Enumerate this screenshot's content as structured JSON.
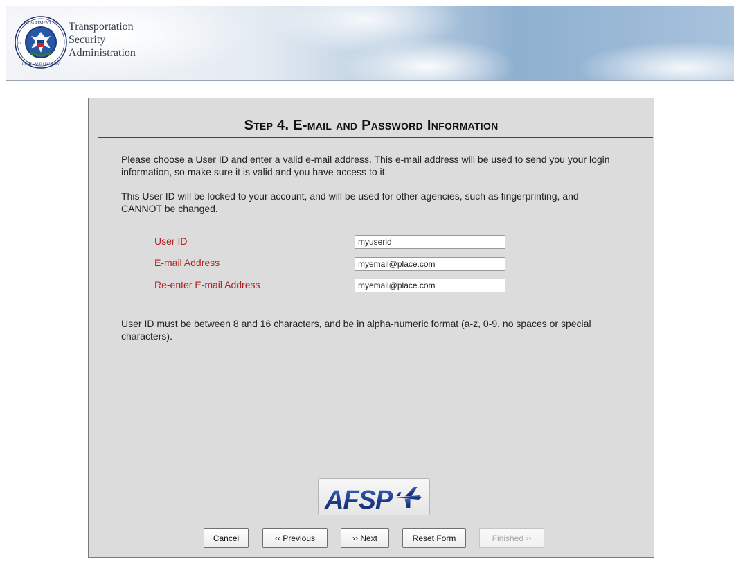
{
  "header": {
    "agency_lines": [
      "Transportation",
      "Security",
      "Administration"
    ],
    "seal_icon": "dhs-seal-icon",
    "seal_text_top": "DEPARTMENT OF",
    "seal_text_left": "U.S.",
    "seal_text_bottom": "HOMELAND SECURITY"
  },
  "step": {
    "title": "Step 4. E-mail and Password Information",
    "intro_paragraph_1": "Please choose a User ID and enter a valid e-mail address. This e-mail address will be used to send you your login information, so make sure it is valid and you have access to it.",
    "intro_paragraph_2": "This User ID will be locked to your account, and will be used for other agencies, such as fingerprinting, and CANNOT be changed."
  },
  "form": {
    "userid": {
      "label": "User ID",
      "value": "myuserid"
    },
    "email": {
      "label": "E-mail Address",
      "value": "myemail@place.com"
    },
    "reemail": {
      "label": "Re-enter E-mail Address",
      "value": "myemail@place.com"
    },
    "rule_note": "User ID must be between 8 and 16 characters, and be in alpha-numeric format (a-z, 0-9, no spaces or special characters)."
  },
  "logo": {
    "text": "AFSP",
    "icon": "airplane-icon"
  },
  "buttons": {
    "cancel": "Cancel",
    "previous": "‹‹ Previous",
    "next": "›› Next",
    "reset": "Reset Form",
    "finished": "Finished ››"
  },
  "colors": {
    "label_red": "#b0231f",
    "panel_bg": "#dcdcdc",
    "logo_blue": "#1f3d8c"
  }
}
